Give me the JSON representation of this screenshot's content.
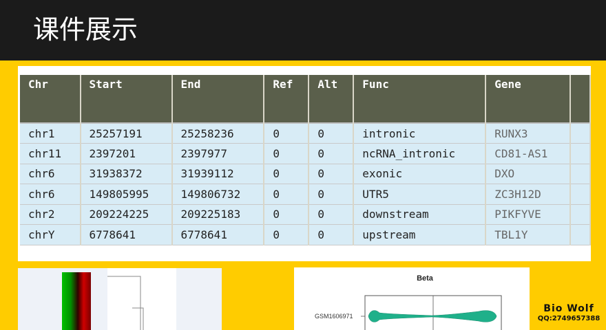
{
  "header": {
    "title": "课件展示"
  },
  "table": {
    "columns": [
      "Chr",
      "Start",
      "End",
      "Ref",
      "Alt",
      "Func",
      "Gene"
    ],
    "rows": [
      [
        "chr1",
        "25257191",
        "25258236",
        "0",
        "0",
        "intronic",
        "RUNX3"
      ],
      [
        "chr11",
        "2397201",
        "2397977",
        "0",
        "0",
        "ncRNA_intronic",
        "CD81-AS1"
      ],
      [
        "chr6",
        "31938372",
        "31939112",
        "0",
        "0",
        "exonic",
        "DXO"
      ],
      [
        "chr6",
        "149805995",
        "149806732",
        "0",
        "0",
        "UTR5",
        "ZC3H12D"
      ],
      [
        "chr2",
        "209224225",
        "209225183",
        "0",
        "0",
        "downstream",
        "PIKFYVE"
      ],
      [
        "chrY",
        "6778641",
        "6778641",
        "0",
        "0",
        "upstream",
        "TBL1Y"
      ]
    ]
  },
  "violin": {
    "title": "Beta",
    "sample_label": "GSM1606971"
  },
  "watermark": {
    "name": "Bio  Wolf",
    "qq": "QQ:2749657388"
  },
  "colors": {
    "accent_background": "#FFCC00",
    "header_background": "#1B1B1B",
    "table_header": "#5A5F4B",
    "table_row": "#D8ECF6",
    "violin_fill": "#1FB08A"
  }
}
